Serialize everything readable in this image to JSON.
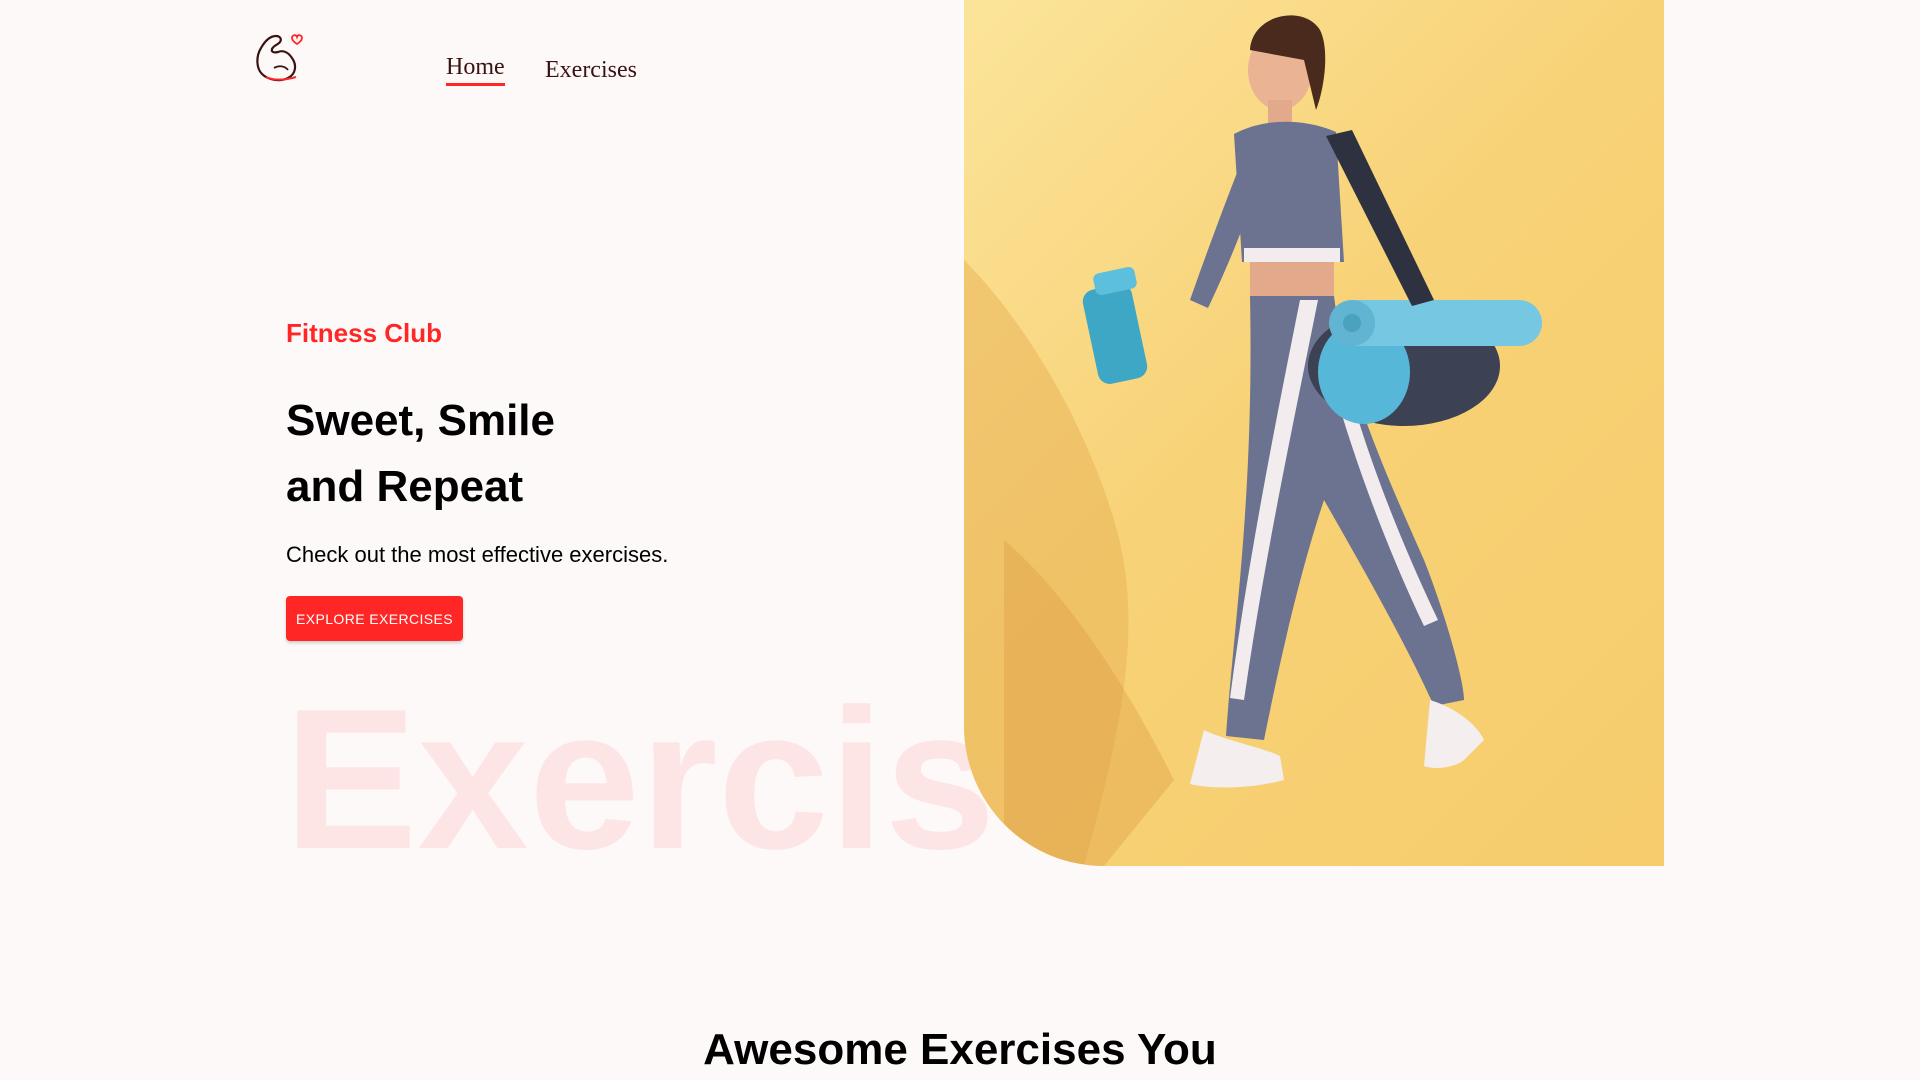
{
  "navbar": {
    "logo_icon": "flexed-arm-heart-icon",
    "links": [
      {
        "label": "Home",
        "active": true
      },
      {
        "label": "Exercises",
        "active": false
      }
    ]
  },
  "hero": {
    "tagline": "Fitness Club",
    "title_line1": "Sweet, Smile",
    "title_line2": "and Repeat",
    "subtitle": "Check out the most effective exercises.",
    "cta_label": "EXPLORE EXERCISES",
    "watermark": "Exercis",
    "banner_image": "woman-walking-with-gym-bag-and-shaker-illustration"
  },
  "section": {
    "title": "Awesome Exercises You"
  },
  "colors": {
    "accent": "#ff2625",
    "background": "#fef9f9",
    "banner_bg": "#f8d277"
  }
}
